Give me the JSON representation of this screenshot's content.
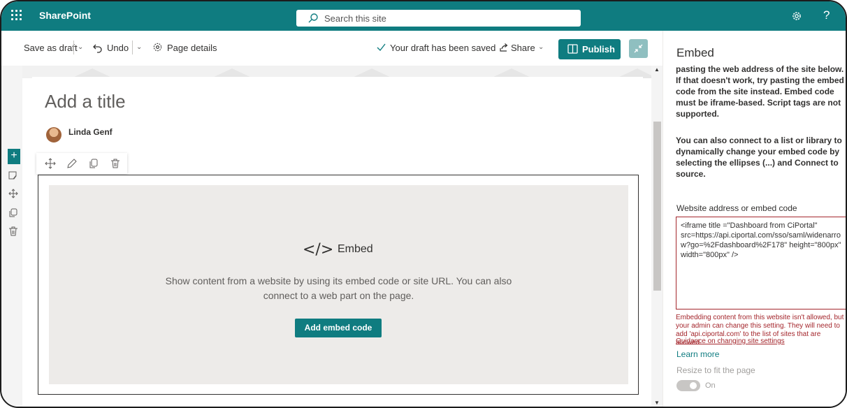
{
  "suite": {
    "app_name": "SharePoint",
    "search_placeholder": "Search this site",
    "help_label": "?"
  },
  "toolbar": {
    "save_as_draft": "Save as draft",
    "undo": "Undo",
    "page_details": "Page details",
    "status": "Your draft has been saved",
    "share": "Share",
    "publish": "Publish"
  },
  "page": {
    "title_placeholder": "Add a title",
    "author": "Linda Genf"
  },
  "webpart": {
    "glyph": "</>",
    "heading": "Embed",
    "description": "Show content from a website by using its embed code or site URL. You can also connect to a web part on the page.",
    "button": "Add embed code"
  },
  "pane": {
    "title": "Embed",
    "intro": "pasting the web address of the site below. If that doesn't work, try pasting the embed code from the site instead. Embed code must be iframe-based. Script tags are not supported.",
    "connect_text": "You can also connect to a list or library to dynamically change your embed code by selecting the ellipses (...) and Connect to source.",
    "field_label": "Website address or embed code",
    "field_value": "<iframe title =\"Dashboard from CiPortal\" src=https://api.ciportal.com/sso/saml/widenarrow?go=%2Fdashboard%2F178\" height=\"800px\" width=\"800px\" />",
    "error": "Embedding content from this website isn't allowed, but your admin can change this setting. They will need to add 'api.ciportal.com' to the list of sites that are allowed.",
    "guidance_link": "Guidance on changing site settings",
    "learn_more": "Learn more",
    "resize_label": "Resize to fit the page",
    "toggle_state": "On"
  },
  "colors": {
    "brand": "#0f7c80",
    "error": "#a4262c"
  }
}
